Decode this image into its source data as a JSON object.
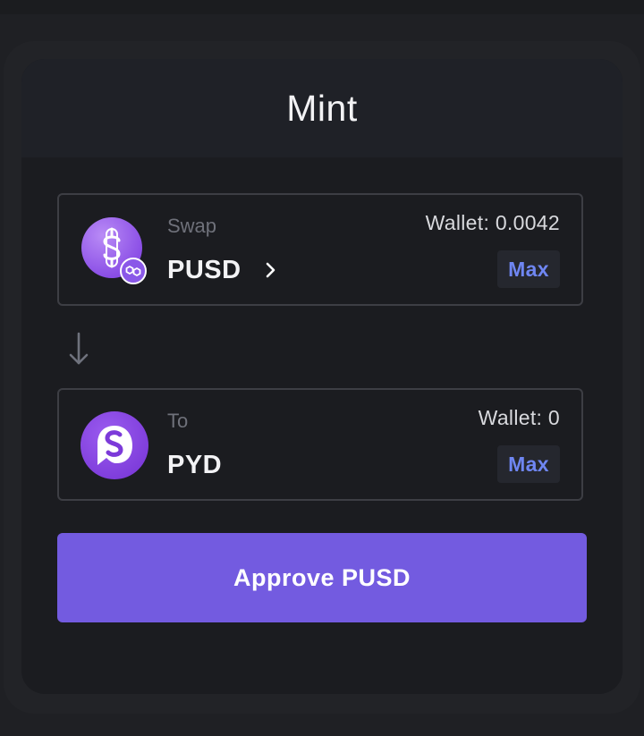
{
  "header": {
    "title": "Mint"
  },
  "from": {
    "label": "Swap",
    "token": "PUSD",
    "token_icon": "pusd-dollar-icon",
    "chain_badge_icon": "polygon-chain-icon",
    "wallet": "Wallet: 0.0042",
    "max_label": "Max"
  },
  "to": {
    "label": "To",
    "token": "PYD",
    "token_icon": "pyd-logo-icon",
    "wallet": "Wallet: 0",
    "max_label": "Max"
  },
  "approve_button": {
    "label": "Approve PUSD"
  },
  "colors": {
    "accent": "#735be0",
    "max_text": "#6f86f2",
    "card_bg": "#1b1c20",
    "page_bg": "#1f2024"
  }
}
